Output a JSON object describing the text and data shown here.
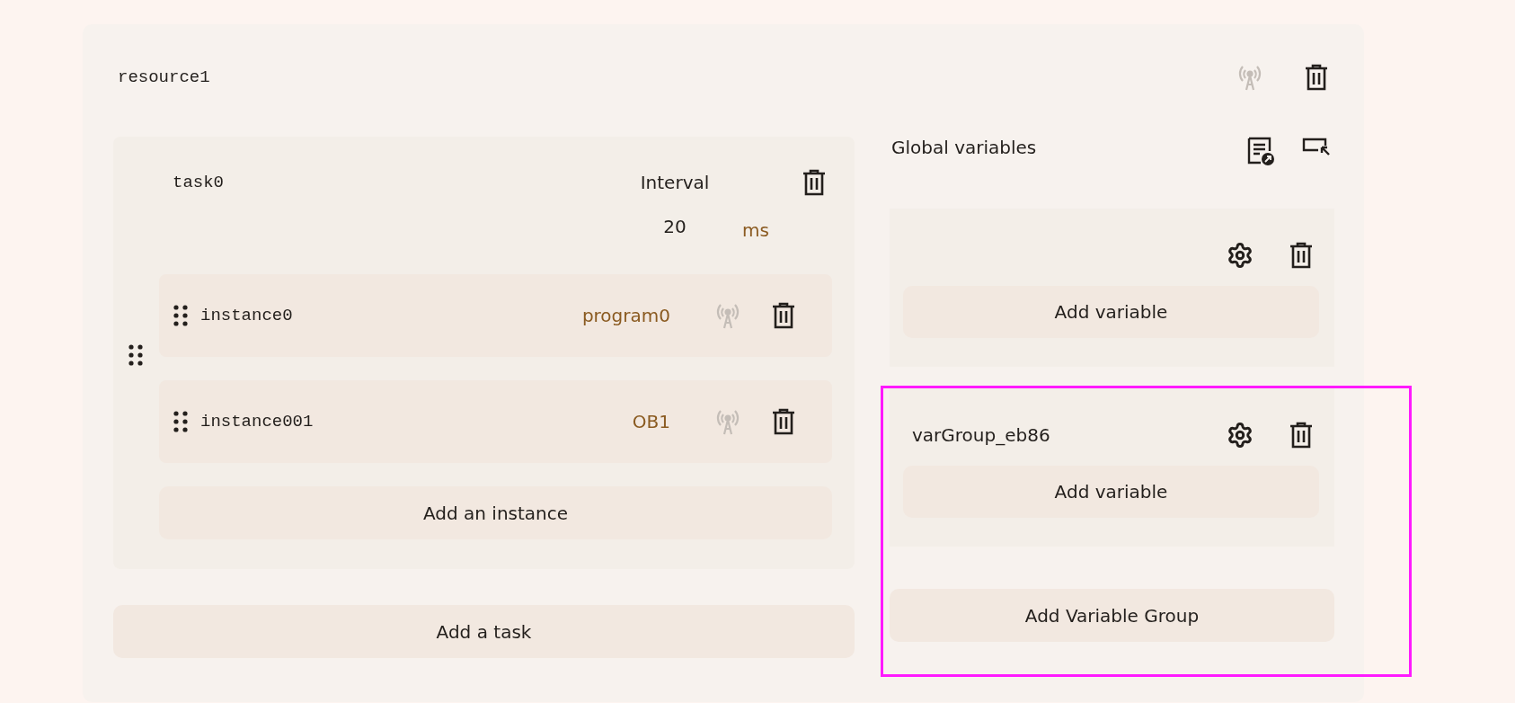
{
  "resource": {
    "name": "resource1",
    "online": false
  },
  "tasks": [
    {
      "name": "task0",
      "interval_label": "Interval",
      "interval": "20",
      "unit": "ms",
      "instances": [
        {
          "name": "instance0",
          "program": "program0",
          "online": false
        },
        {
          "name": "instance001",
          "program": "OB1",
          "online": false
        }
      ],
      "add_instance": "Add an instance"
    }
  ],
  "add_task": "Add a task",
  "global_variables": {
    "title": "Global variables",
    "groups": [
      {
        "add_variable": "Add variable",
        "highlighted": false
      },
      {
        "name": "varGroup_eb86",
        "add_variable": "Add variable",
        "highlighted": true
      }
    ],
    "add_group": "Add Variable Group"
  }
}
